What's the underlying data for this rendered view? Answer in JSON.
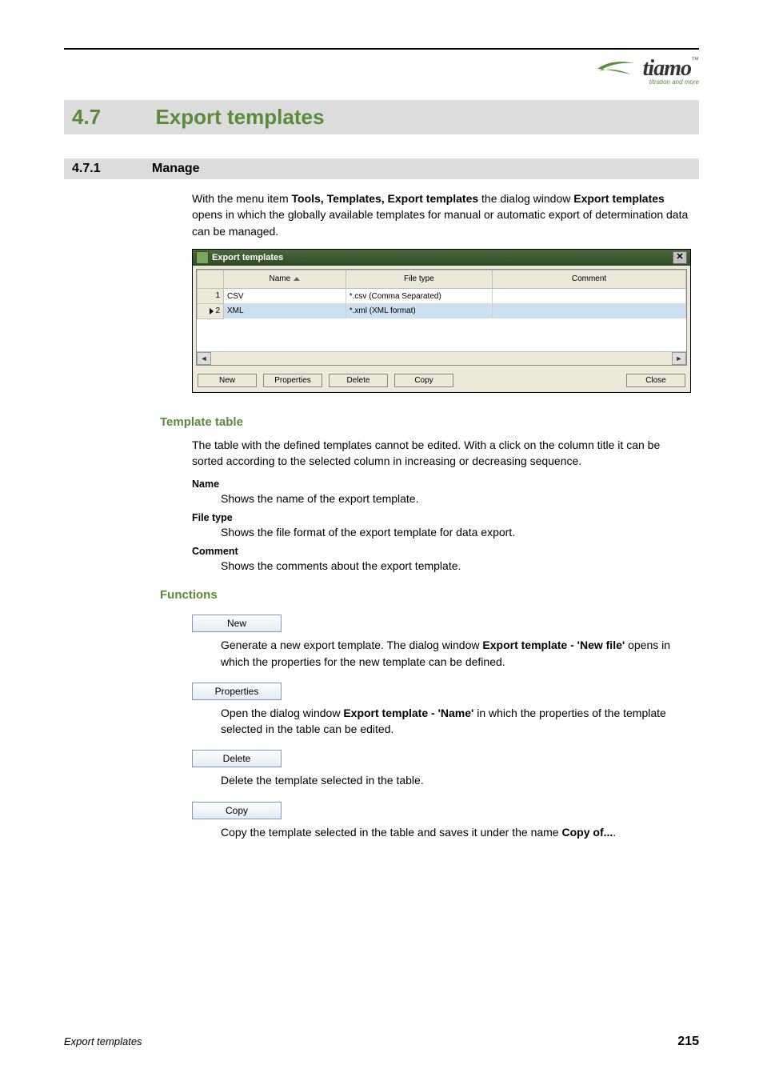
{
  "logo": {
    "brand": "tiamo",
    "tm": "™",
    "sub": "titration and more"
  },
  "section": {
    "number": "4.7",
    "title": "Export templates"
  },
  "subsection": {
    "number": "4.7.1",
    "title": "Manage"
  },
  "intro": {
    "p1a": "With the menu item ",
    "p1b": "Tools, Templates, Export templates",
    "p1c": " the dialog window ",
    "p1d": "Export templates",
    "p1e": " opens in which the globally available templates for manual or automatic export of determination data can be managed."
  },
  "dialog": {
    "title": "Export templates",
    "close": "✕",
    "columns": {
      "name": "Name",
      "filetype": "File type",
      "comment": "Comment"
    },
    "rows": [
      {
        "num": "1",
        "name": "CSV",
        "filetype": "*.csv (Comma Separated)",
        "comment": "",
        "selected": false,
        "pointer": false
      },
      {
        "num": "2",
        "name": "XML",
        "filetype": "*.xml (XML format)",
        "comment": "",
        "selected": true,
        "pointer": true
      }
    ],
    "scroll": {
      "left": "◄",
      "right": "►"
    },
    "buttons": {
      "new": "New",
      "properties": "Properties",
      "delete": "Delete",
      "copy": "Copy",
      "close": "Close"
    }
  },
  "template_table": {
    "heading": "Template table",
    "para": "The table with the defined templates cannot be edited. With a click on the column title it can be sorted according to the selected column in increasing or decreasing sequence.",
    "defs": {
      "name_t": "Name",
      "name_b": "Shows the name of the export template.",
      "filetype_t": "File type",
      "filetype_b": "Shows the file format of the export template for data export.",
      "comment_t": "Comment",
      "comment_b": "Shows the comments about the export template."
    }
  },
  "functions": {
    "heading": "Functions",
    "new_btn": "New",
    "new_a": "Generate a new export template. The dialog window ",
    "new_b": "Export template - 'New file'",
    "new_c": " opens in which the properties for the new template can be defined.",
    "prop_btn": "Properties",
    "prop_a": "Open the dialog window ",
    "prop_b": "Export template - 'Name'",
    "prop_c": " in which the properties of the template selected in the table can be edited.",
    "del_btn": "Delete",
    "del_desc": "Delete the template selected in the table.",
    "copy_btn": "Copy",
    "copy_a": "Copy the template selected in the table and saves it under the name ",
    "copy_b": "Copy of...",
    "copy_c": "."
  },
  "footer": {
    "left": "Export templates",
    "right": "215"
  }
}
